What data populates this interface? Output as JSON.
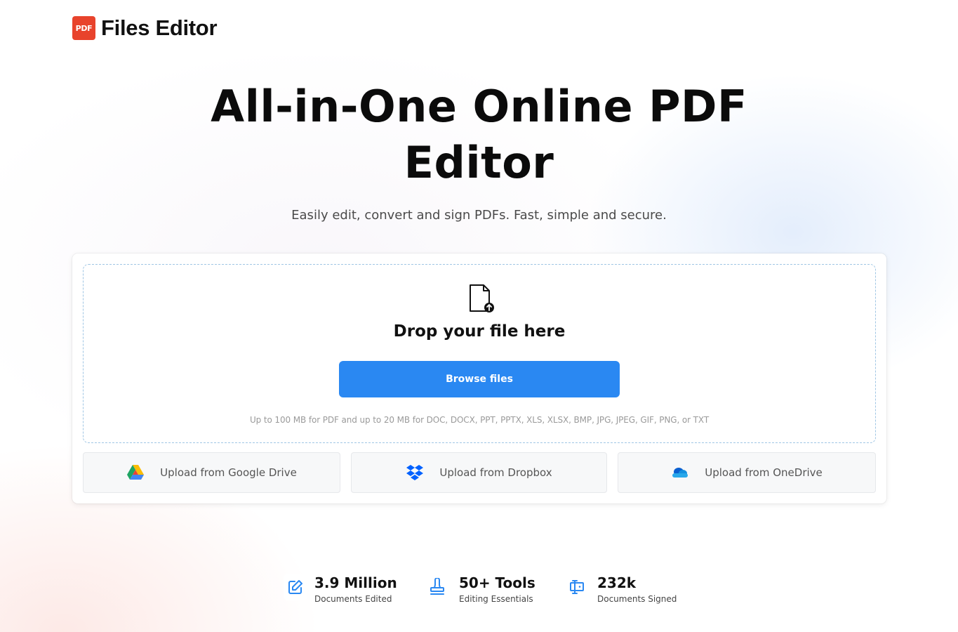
{
  "header": {
    "logo_badge": "PDF",
    "brand": "Files Editor"
  },
  "hero": {
    "title_line1": "All-in-One Online PDF",
    "title_line2": "Editor",
    "subtitle": "Easily edit, convert and sign PDFs. Fast, simple and secure."
  },
  "upload": {
    "drop_title": "Drop your file here",
    "browse_label": "Browse files",
    "limits": "Up to 100 MB for PDF and up to 20 MB for DOC, DOCX, PPT, PPTX, XLS, XLSX, BMP, JPG, JPEG, GIF, PNG, or TXT",
    "icon": "file-upload-icon"
  },
  "sources": [
    {
      "label": "Upload from Google Drive",
      "icon": "google-drive-icon"
    },
    {
      "label": "Upload from Dropbox",
      "icon": "dropbox-icon"
    },
    {
      "label": "Upload from OneDrive",
      "icon": "onedrive-icon"
    }
  ],
  "stats": [
    {
      "value": "3.9 Million",
      "label": "Documents Edited",
      "icon": "edit-icon"
    },
    {
      "value": "50+ Tools",
      "label": "Editing Essentials",
      "icon": "stamp-icon"
    },
    {
      "value": "232k",
      "label": "Documents Signed",
      "icon": "sign-icon"
    }
  ],
  "colors": {
    "accent": "#2a88f2",
    "logo": "#e8432c",
    "icon_blue": "#2a88f2"
  }
}
